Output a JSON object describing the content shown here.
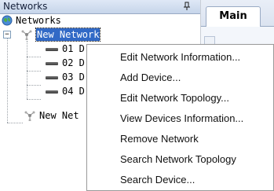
{
  "panel": {
    "title": "Networks",
    "pin_icon": "pin-icon"
  },
  "tree": {
    "root": {
      "label": "Networks",
      "icon": "globe-icon"
    },
    "network1": {
      "label": "New Network",
      "icon": "network-icon",
      "toggle": "−"
    },
    "devices": [
      {
        "label": "01 D",
        "icon": "device-icon"
      },
      {
        "label": "02 D",
        "icon": "device-icon"
      },
      {
        "label": "03 D",
        "icon": "device-icon"
      },
      {
        "label": "04 D",
        "icon": "device-icon"
      }
    ],
    "network2": {
      "label": "New Net",
      "icon": "network-icon"
    }
  },
  "tabs": {
    "main_label": "Main"
  },
  "context_menu": {
    "items": [
      "Edit Network Information...",
      "Add Device...",
      "Edit Network Topology...",
      "View Devices Information...",
      "Remove Network",
      "Search Network Topology",
      "Search Device..."
    ]
  },
  "colors": {
    "selection": "#3169c6",
    "header_bg": "#c6d5ea"
  }
}
